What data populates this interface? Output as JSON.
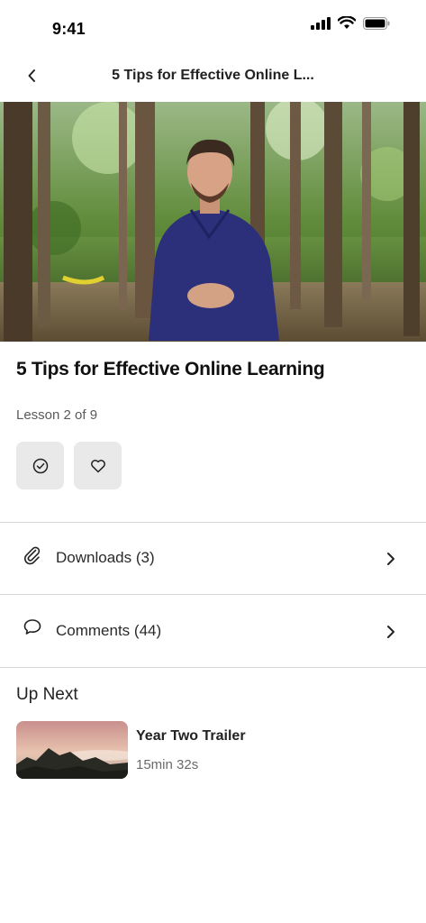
{
  "status_bar": {
    "time": "9:41",
    "icons": [
      "signal-icon",
      "wifi-icon",
      "battery-icon"
    ]
  },
  "nav": {
    "back_icon": "chevron-left-icon",
    "title": "5 Tips for Effective Online L..."
  },
  "video": {
    "description_icon": "video-thumbnail"
  },
  "lesson": {
    "title": "5 Tips for Effective Online Learning",
    "progress": "Lesson 2 of 9",
    "actions": [
      {
        "icon": "check-circle-icon"
      },
      {
        "icon": "heart-icon"
      }
    ]
  },
  "rows": {
    "downloads": {
      "icon": "paperclip-icon",
      "label": "Downloads (3)",
      "chevron": "chevron-right-icon"
    },
    "comments": {
      "icon": "chat-bubble-icon",
      "label": "Comments (44)",
      "chevron": "chevron-right-icon"
    }
  },
  "up_next": {
    "heading": "Up Next",
    "items": [
      {
        "title": "Year Two Trailer",
        "duration": "15min 32s"
      }
    ]
  },
  "colors": {
    "button_bg": "#e9e9e9",
    "divider": "#d8d8d8",
    "text_primary": "#111111",
    "text_secondary": "#5a5a5a"
  }
}
